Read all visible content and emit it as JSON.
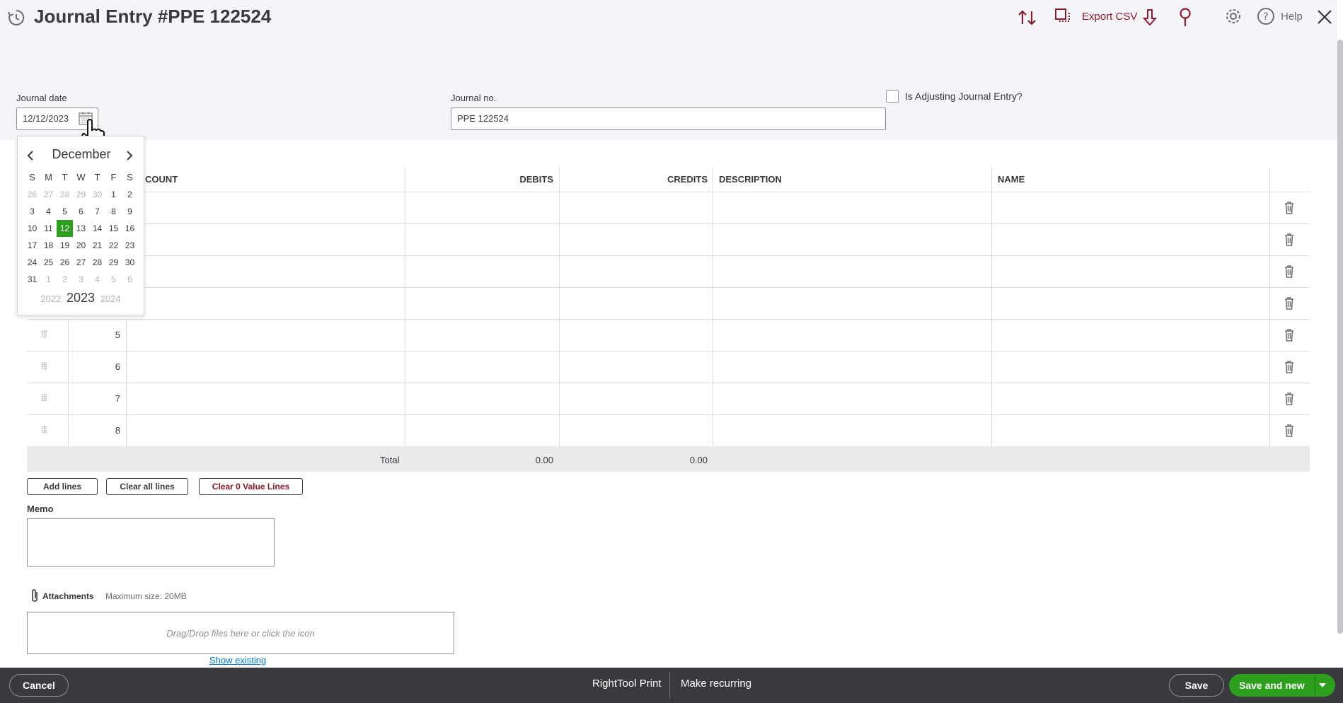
{
  "header": {
    "title": "Journal Entry #PPE 122524",
    "export_label": "Export CSV",
    "help_label": "Help"
  },
  "form": {
    "journal_date_label": "Journal date",
    "journal_date_value": "12/12/2023",
    "journal_no_label": "Journal no.",
    "journal_no_value": "PPE 122524",
    "adjusting_label": "Is Adjusting Journal Entry?"
  },
  "table": {
    "columns": [
      "COUNT",
      "DEBITS",
      "CREDITS",
      "DESCRIPTION",
      "NAME"
    ],
    "rows": [
      "5",
      "6",
      "7",
      "8"
    ],
    "total_label": "Total",
    "total_debits": "0.00",
    "total_credits": "0.00"
  },
  "actions": {
    "add_lines": "Add lines",
    "clear_all": "Clear all lines",
    "clear_zero": "Clear 0 Value Lines"
  },
  "memo": {
    "label": "Memo"
  },
  "attachments": {
    "label": "Attachments",
    "max_size": "Maximum size: 20MB",
    "drop_text": "Drag/Drop files here or click the icon",
    "show_existing": "Show existing"
  },
  "calendar": {
    "month": "December",
    "days_of_week": [
      "S",
      "M",
      "T",
      "W",
      "T",
      "F",
      "S"
    ],
    "weeks": [
      [
        "26",
        "27",
        "28",
        "29",
        "30",
        "1",
        "2"
      ],
      [
        "3",
        "4",
        "5",
        "6",
        "7",
        "8",
        "9"
      ],
      [
        "10",
        "11",
        "12",
        "13",
        "14",
        "15",
        "16"
      ],
      [
        "17",
        "18",
        "19",
        "20",
        "21",
        "22",
        "23"
      ],
      [
        "24",
        "25",
        "26",
        "27",
        "28",
        "29",
        "30"
      ],
      [
        "31",
        "1",
        "2",
        "3",
        "4",
        "5",
        "6"
      ]
    ],
    "selected_day": "12",
    "year_prev": "2022",
    "year_current": "2023",
    "year_next": "2024"
  },
  "footer": {
    "cancel": "Cancel",
    "print": "RightTool Print",
    "recurring": "Make recurring",
    "save": "Save",
    "save_and_new": "Save and new"
  },
  "colors": {
    "accent_green": "#2ca01c",
    "accent_red": "#8d1a2b",
    "footer_bg": "#393a3d"
  }
}
